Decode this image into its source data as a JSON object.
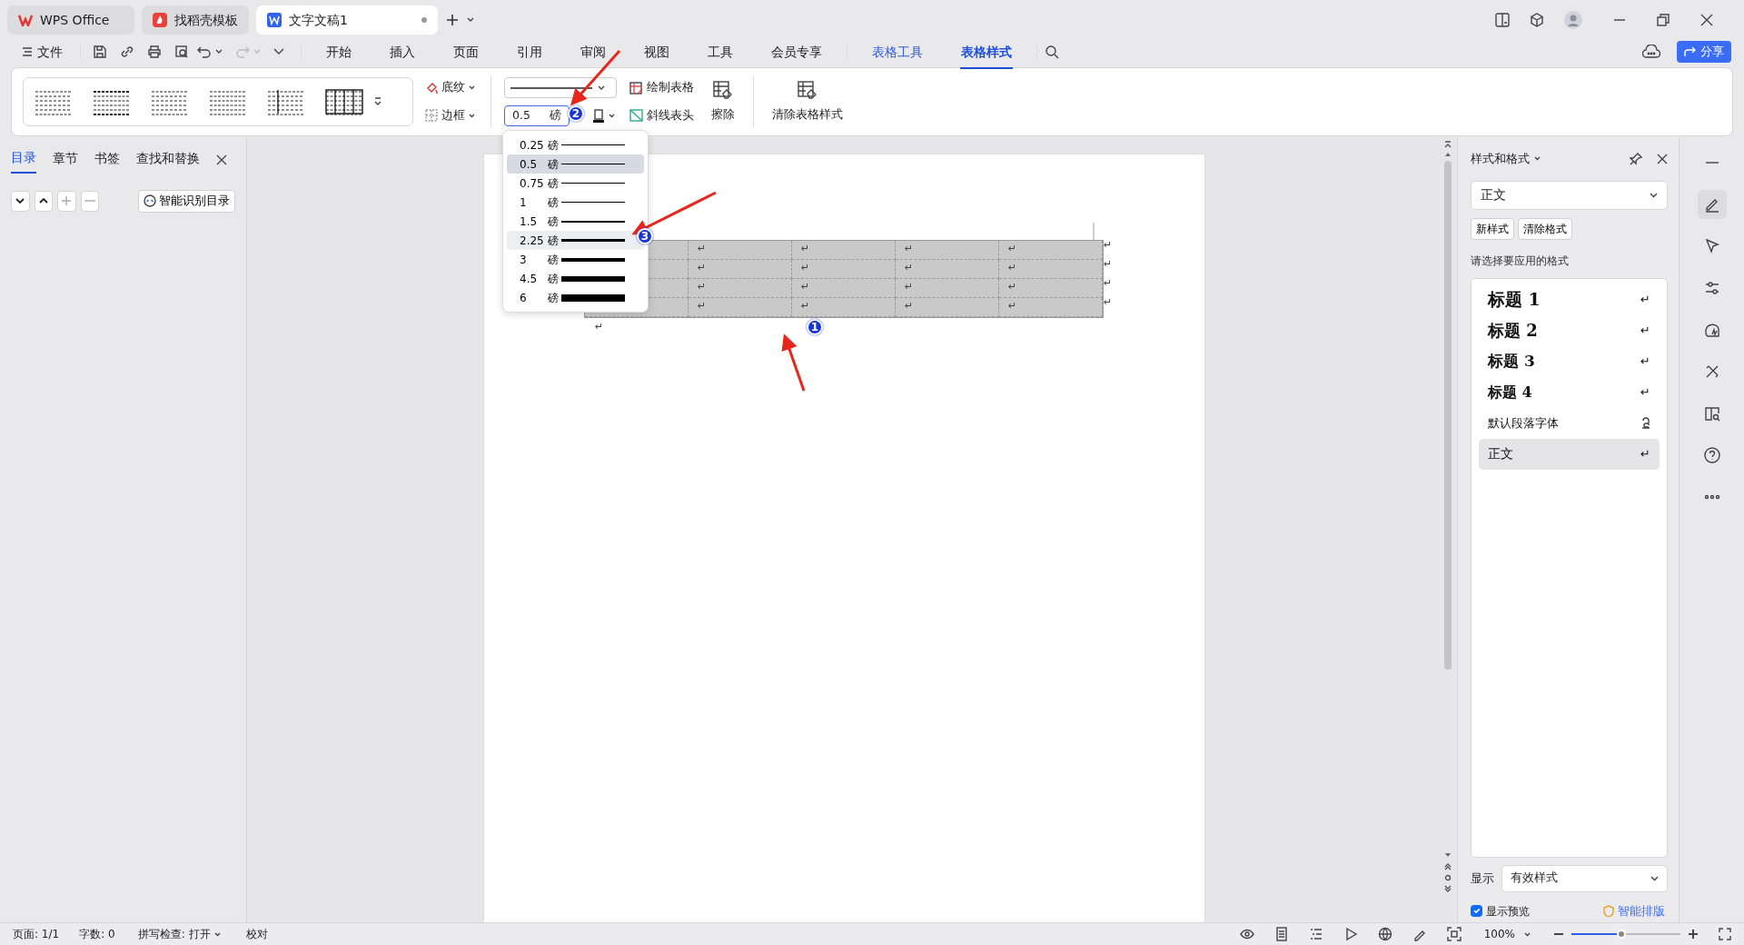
{
  "app_tabs": [
    {
      "label": "WPS Office",
      "kind": "home",
      "selected": false
    },
    {
      "label": "找稻壳模板",
      "kind": "template",
      "selected": false
    },
    {
      "label": "文字文稿1",
      "kind": "doc",
      "selected": true
    }
  ],
  "menu": {
    "file": "文件",
    "items": [
      {
        "label": "开始",
        "kind": "plain",
        "selected": false
      },
      {
        "label": "插入",
        "kind": "plain",
        "selected": false
      },
      {
        "label": "页面",
        "kind": "plain",
        "selected": false
      },
      {
        "label": "引用",
        "kind": "plain",
        "selected": false
      },
      {
        "label": "审阅",
        "kind": "plain",
        "selected": false
      },
      {
        "label": "视图",
        "kind": "plain",
        "selected": false
      },
      {
        "label": "工具",
        "kind": "plain",
        "selected": false
      },
      {
        "label": "会员专享",
        "kind": "plain",
        "selected": false
      },
      {
        "label": "表格工具",
        "kind": "context",
        "selected": false
      },
      {
        "label": "表格样式",
        "kind": "context",
        "selected": true
      }
    ],
    "share": "分享"
  },
  "ribbon": {
    "shading": "底纹",
    "border": "边框",
    "line_width": {
      "value": "0.5",
      "unit": "磅"
    },
    "draw_table": "绘制表格",
    "diagonal_header": "斜线表头",
    "erase": "擦除",
    "clear_style": "清除表格样式"
  },
  "width_menu": [
    {
      "value": "0.25",
      "unit": "磅",
      "selected": false,
      "hovered": false
    },
    {
      "value": "0.5",
      "unit": "磅",
      "selected": true,
      "hovered": false
    },
    {
      "value": "0.75",
      "unit": "磅",
      "selected": false,
      "hovered": false
    },
    {
      "value": "1",
      "unit": "磅",
      "selected": false,
      "hovered": false
    },
    {
      "value": "1.5",
      "unit": "磅",
      "selected": false,
      "hovered": false
    },
    {
      "value": "2.25",
      "unit": "磅",
      "selected": false,
      "hovered": true
    },
    {
      "value": "3",
      "unit": "磅",
      "selected": false,
      "hovered": false
    },
    {
      "value": "4.5",
      "unit": "磅",
      "selected": false,
      "hovered": false
    },
    {
      "value": "6",
      "unit": "磅",
      "selected": false,
      "hovered": false
    }
  ],
  "left_panel": {
    "tabs": [
      {
        "label": "目录",
        "selected": true
      },
      {
        "label": "章节",
        "selected": false
      },
      {
        "label": "书签",
        "selected": false
      },
      {
        "label": "查找和替换",
        "selected": false
      }
    ],
    "smart_toc": "智能识别目录"
  },
  "document": {
    "table": {
      "rows": [
        {
          "cells": [
            "↵",
            "↵",
            "↵",
            "↵"
          ],
          "end": "↵"
        },
        {
          "cells": [
            "↵",
            "↵",
            "↵",
            "↵"
          ],
          "end": "↵"
        },
        {
          "cells": [
            "↵",
            "↵",
            "↵",
            "↵"
          ],
          "end": "↵"
        },
        {
          "cells": [
            "↵",
            "↵",
            "↵",
            "↵"
          ],
          "end": "↵"
        }
      ]
    },
    "paragraph_mark": "↵"
  },
  "annotations": [
    {
      "number": "1"
    },
    {
      "number": "2"
    },
    {
      "number": "3"
    }
  ],
  "style_panel": {
    "title": "样式和格式",
    "current": "正文",
    "buttons": [
      "新样式",
      "清除格式"
    ],
    "prompt": "请选择要应用的格式",
    "styles": [
      {
        "label": "标题 1",
        "kind": "heading1",
        "mark": "↵",
        "selected": false
      },
      {
        "label": "标题 2",
        "kind": "heading2",
        "mark": "↵",
        "selected": false
      },
      {
        "label": "标题 3",
        "kind": "heading3",
        "mark": "↵",
        "selected": false
      },
      {
        "label": "标题 4",
        "kind": "heading4",
        "mark": "↵",
        "selected": false
      },
      {
        "label": "默认段落字体",
        "kind": "character",
        "selected": false
      },
      {
        "label": "正文",
        "kind": "body",
        "mark": "↵",
        "selected": true
      }
    ],
    "show_label": "显示",
    "show_value": "有效样式",
    "preview": {
      "label": "显示预览",
      "checked": true
    },
    "smart_layout": "智能排版"
  },
  "status_bar": {
    "page": "页面: 1/1",
    "words": "字数: 0",
    "spell": "拼写检查: 打开",
    "proof": "校对",
    "zoom": "100%",
    "zoom_slider": {
      "level": 0.42
    }
  }
}
